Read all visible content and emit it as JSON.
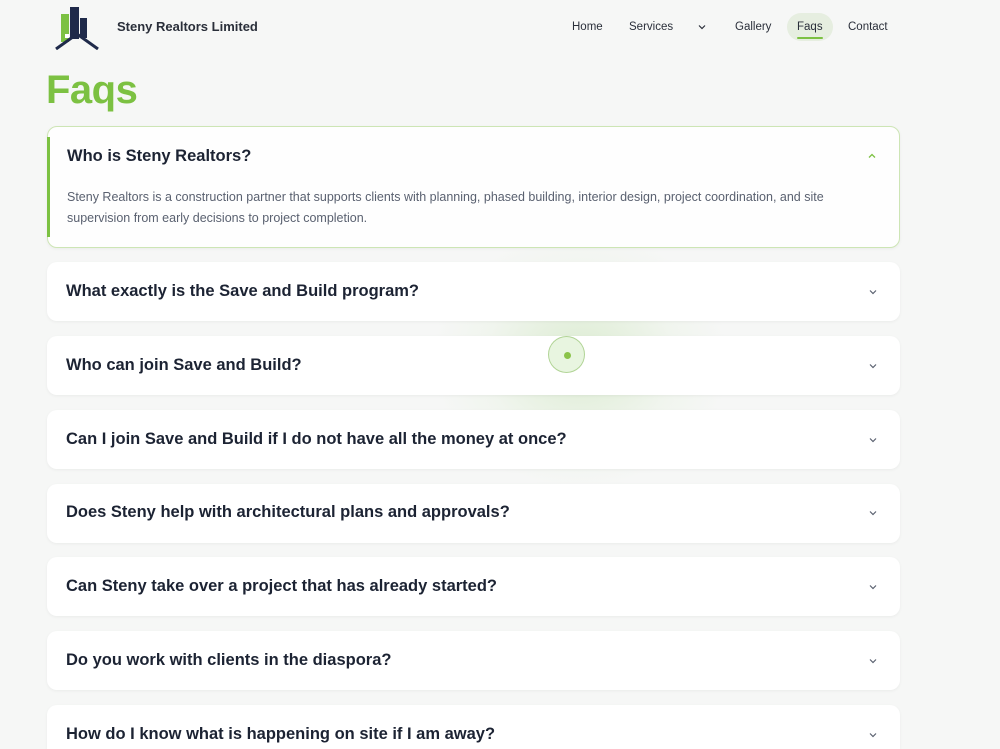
{
  "header": {
    "brand": "Steny Realtors Limited",
    "logo_icon": "building-house-logo-icon",
    "nav": [
      {
        "label": "Home"
      },
      {
        "label": "Services"
      },
      {
        "label": "Gallery"
      },
      {
        "label": "Faqs",
        "active": true
      },
      {
        "label": "Contact"
      }
    ]
  },
  "page": {
    "title": "Faqs"
  },
  "faqs": [
    {
      "question": "Who is Steny Realtors?",
      "answer": "Steny Realtors is a construction partner that supports clients with planning, phased building, interior design, project coordination, and site supervision from early decisions to project completion.",
      "expanded": true
    },
    {
      "question": "What exactly is the Save and Build program?",
      "expanded": false
    },
    {
      "question": "Who can join Save and Build?",
      "expanded": false
    },
    {
      "question": "Can I join Save and Build if I do not have all the money at once?",
      "expanded": false
    },
    {
      "question": "Does Steny help with architectural plans and approvals?",
      "expanded": false
    },
    {
      "question": "Can Steny take over a project that has already started?",
      "expanded": false
    },
    {
      "question": "Do you work with clients in the diaspora?",
      "expanded": false
    },
    {
      "question": "How do I know what is happening on site if I am away?",
      "expanded": false
    }
  ],
  "colors": {
    "accent": "#7cc142",
    "text_dark": "#1c2333",
    "logo_navy": "#1f2a4a"
  }
}
